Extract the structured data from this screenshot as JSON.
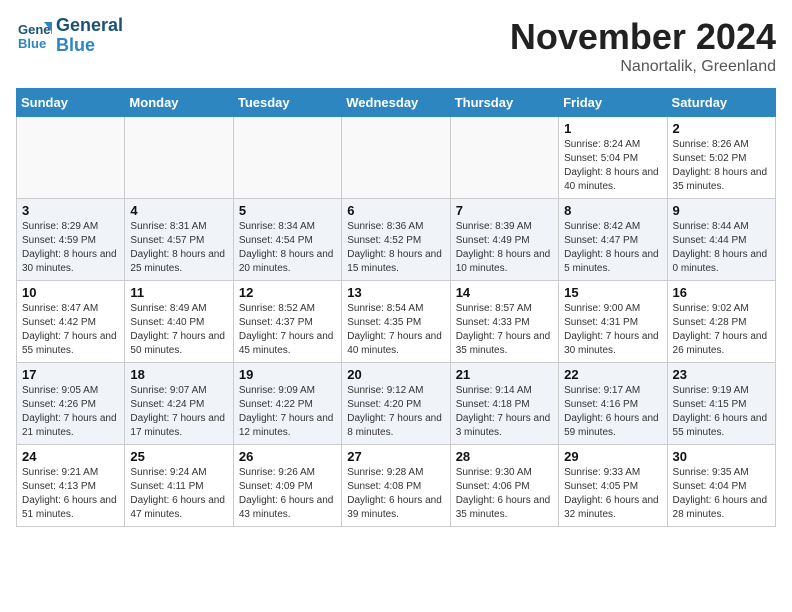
{
  "header": {
    "logo_line1": "General",
    "logo_line2": "Blue",
    "month": "November 2024",
    "location": "Nanortalik, Greenland"
  },
  "weekdays": [
    "Sunday",
    "Monday",
    "Tuesday",
    "Wednesday",
    "Thursday",
    "Friday",
    "Saturday"
  ],
  "weeks": [
    [
      {
        "day": "",
        "info": ""
      },
      {
        "day": "",
        "info": ""
      },
      {
        "day": "",
        "info": ""
      },
      {
        "day": "",
        "info": ""
      },
      {
        "day": "",
        "info": ""
      },
      {
        "day": "1",
        "info": "Sunrise: 8:24 AM\nSunset: 5:04 PM\nDaylight: 8 hours and 40 minutes."
      },
      {
        "day": "2",
        "info": "Sunrise: 8:26 AM\nSunset: 5:02 PM\nDaylight: 8 hours and 35 minutes."
      }
    ],
    [
      {
        "day": "3",
        "info": "Sunrise: 8:29 AM\nSunset: 4:59 PM\nDaylight: 8 hours and 30 minutes."
      },
      {
        "day": "4",
        "info": "Sunrise: 8:31 AM\nSunset: 4:57 PM\nDaylight: 8 hours and 25 minutes."
      },
      {
        "day": "5",
        "info": "Sunrise: 8:34 AM\nSunset: 4:54 PM\nDaylight: 8 hours and 20 minutes."
      },
      {
        "day": "6",
        "info": "Sunrise: 8:36 AM\nSunset: 4:52 PM\nDaylight: 8 hours and 15 minutes."
      },
      {
        "day": "7",
        "info": "Sunrise: 8:39 AM\nSunset: 4:49 PM\nDaylight: 8 hours and 10 minutes."
      },
      {
        "day": "8",
        "info": "Sunrise: 8:42 AM\nSunset: 4:47 PM\nDaylight: 8 hours and 5 minutes."
      },
      {
        "day": "9",
        "info": "Sunrise: 8:44 AM\nSunset: 4:44 PM\nDaylight: 8 hours and 0 minutes."
      }
    ],
    [
      {
        "day": "10",
        "info": "Sunrise: 8:47 AM\nSunset: 4:42 PM\nDaylight: 7 hours and 55 minutes."
      },
      {
        "day": "11",
        "info": "Sunrise: 8:49 AM\nSunset: 4:40 PM\nDaylight: 7 hours and 50 minutes."
      },
      {
        "day": "12",
        "info": "Sunrise: 8:52 AM\nSunset: 4:37 PM\nDaylight: 7 hours and 45 minutes."
      },
      {
        "day": "13",
        "info": "Sunrise: 8:54 AM\nSunset: 4:35 PM\nDaylight: 7 hours and 40 minutes."
      },
      {
        "day": "14",
        "info": "Sunrise: 8:57 AM\nSunset: 4:33 PM\nDaylight: 7 hours and 35 minutes."
      },
      {
        "day": "15",
        "info": "Sunrise: 9:00 AM\nSunset: 4:31 PM\nDaylight: 7 hours and 30 minutes."
      },
      {
        "day": "16",
        "info": "Sunrise: 9:02 AM\nSunset: 4:28 PM\nDaylight: 7 hours and 26 minutes."
      }
    ],
    [
      {
        "day": "17",
        "info": "Sunrise: 9:05 AM\nSunset: 4:26 PM\nDaylight: 7 hours and 21 minutes."
      },
      {
        "day": "18",
        "info": "Sunrise: 9:07 AM\nSunset: 4:24 PM\nDaylight: 7 hours and 17 minutes."
      },
      {
        "day": "19",
        "info": "Sunrise: 9:09 AM\nSunset: 4:22 PM\nDaylight: 7 hours and 12 minutes."
      },
      {
        "day": "20",
        "info": "Sunrise: 9:12 AM\nSunset: 4:20 PM\nDaylight: 7 hours and 8 minutes."
      },
      {
        "day": "21",
        "info": "Sunrise: 9:14 AM\nSunset: 4:18 PM\nDaylight: 7 hours and 3 minutes."
      },
      {
        "day": "22",
        "info": "Sunrise: 9:17 AM\nSunset: 4:16 PM\nDaylight: 6 hours and 59 minutes."
      },
      {
        "day": "23",
        "info": "Sunrise: 9:19 AM\nSunset: 4:15 PM\nDaylight: 6 hours and 55 minutes."
      }
    ],
    [
      {
        "day": "24",
        "info": "Sunrise: 9:21 AM\nSunset: 4:13 PM\nDaylight: 6 hours and 51 minutes."
      },
      {
        "day": "25",
        "info": "Sunrise: 9:24 AM\nSunset: 4:11 PM\nDaylight: 6 hours and 47 minutes."
      },
      {
        "day": "26",
        "info": "Sunrise: 9:26 AM\nSunset: 4:09 PM\nDaylight: 6 hours and 43 minutes."
      },
      {
        "day": "27",
        "info": "Sunrise: 9:28 AM\nSunset: 4:08 PM\nDaylight: 6 hours and 39 minutes."
      },
      {
        "day": "28",
        "info": "Sunrise: 9:30 AM\nSunset: 4:06 PM\nDaylight: 6 hours and 35 minutes."
      },
      {
        "day": "29",
        "info": "Sunrise: 9:33 AM\nSunset: 4:05 PM\nDaylight: 6 hours and 32 minutes."
      },
      {
        "day": "30",
        "info": "Sunrise: 9:35 AM\nSunset: 4:04 PM\nDaylight: 6 hours and 28 minutes."
      }
    ]
  ]
}
